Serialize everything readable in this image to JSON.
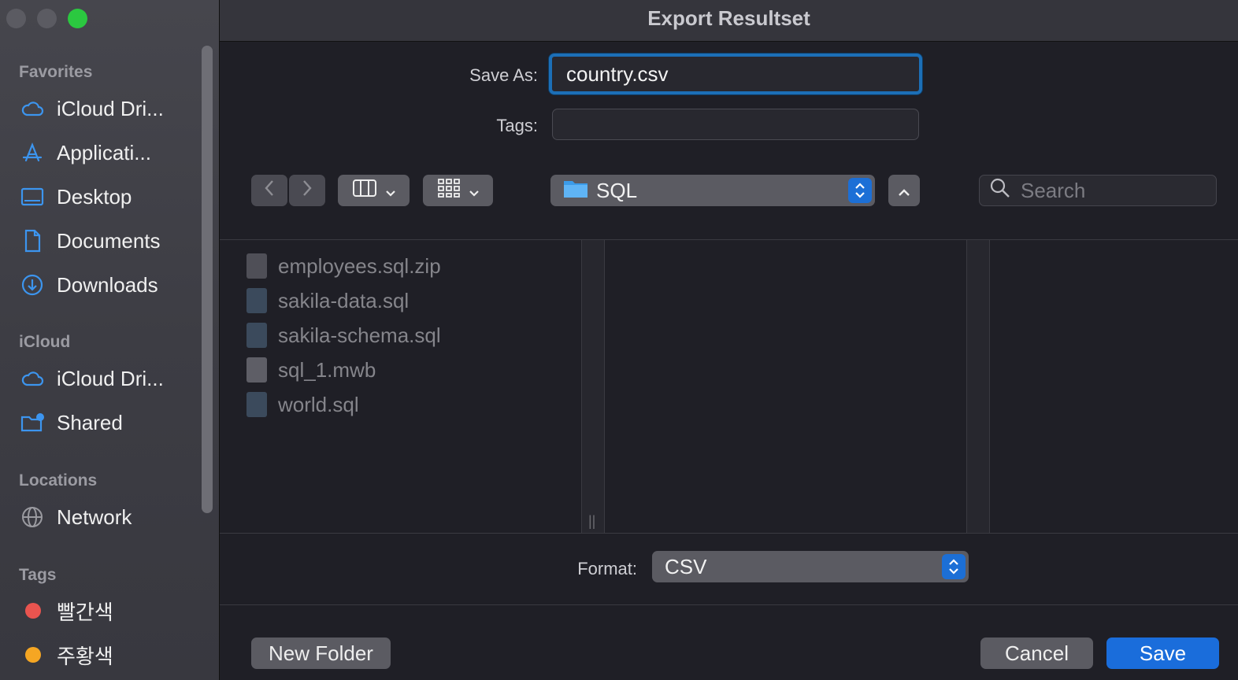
{
  "window": {
    "title": "Export Resultset"
  },
  "sidebar": {
    "sections": [
      {
        "title": "Favorites",
        "items": [
          {
            "label": "iCloud Dri...",
            "icon": "cloud-icon"
          },
          {
            "label": "Applicati...",
            "icon": "applications-icon"
          },
          {
            "label": "Desktop",
            "icon": "desktop-icon"
          },
          {
            "label": "Documents",
            "icon": "document-icon"
          },
          {
            "label": "Downloads",
            "icon": "download-icon"
          }
        ]
      },
      {
        "title": "iCloud",
        "items": [
          {
            "label": "iCloud Dri...",
            "icon": "cloud-icon"
          },
          {
            "label": "Shared",
            "icon": "shared-folder-icon"
          }
        ]
      },
      {
        "title": "Locations",
        "items": [
          {
            "label": "Network",
            "icon": "globe-icon"
          }
        ]
      },
      {
        "title": "Tags",
        "items": [
          {
            "label": "빨간색",
            "color": "#e9544f"
          },
          {
            "label": "주황색",
            "color": "#f5a623"
          }
        ]
      }
    ]
  },
  "form": {
    "save_as_label": "Save As:",
    "save_as_value": "country.csv",
    "tags_label": "Tags:",
    "tags_value": ""
  },
  "toolbar": {
    "location": "SQL",
    "search_placeholder": "Search"
  },
  "files": [
    {
      "name": "employees.sql.zip",
      "type": "zip"
    },
    {
      "name": "sakila-data.sql",
      "type": "sql"
    },
    {
      "name": "sakila-schema.sql",
      "type": "sql"
    },
    {
      "name": "sql_1.mwb",
      "type": "mwb"
    },
    {
      "name": "world.sql",
      "type": "sql"
    }
  ],
  "format": {
    "label": "Format:",
    "value": "CSV"
  },
  "buttons": {
    "new_folder": "New Folder",
    "cancel": "Cancel",
    "save": "Save"
  },
  "colors": {
    "accent": "#1a6ddb",
    "focus_ring": "#1c6fb7",
    "sidebar_icon": "#3c95ef"
  }
}
